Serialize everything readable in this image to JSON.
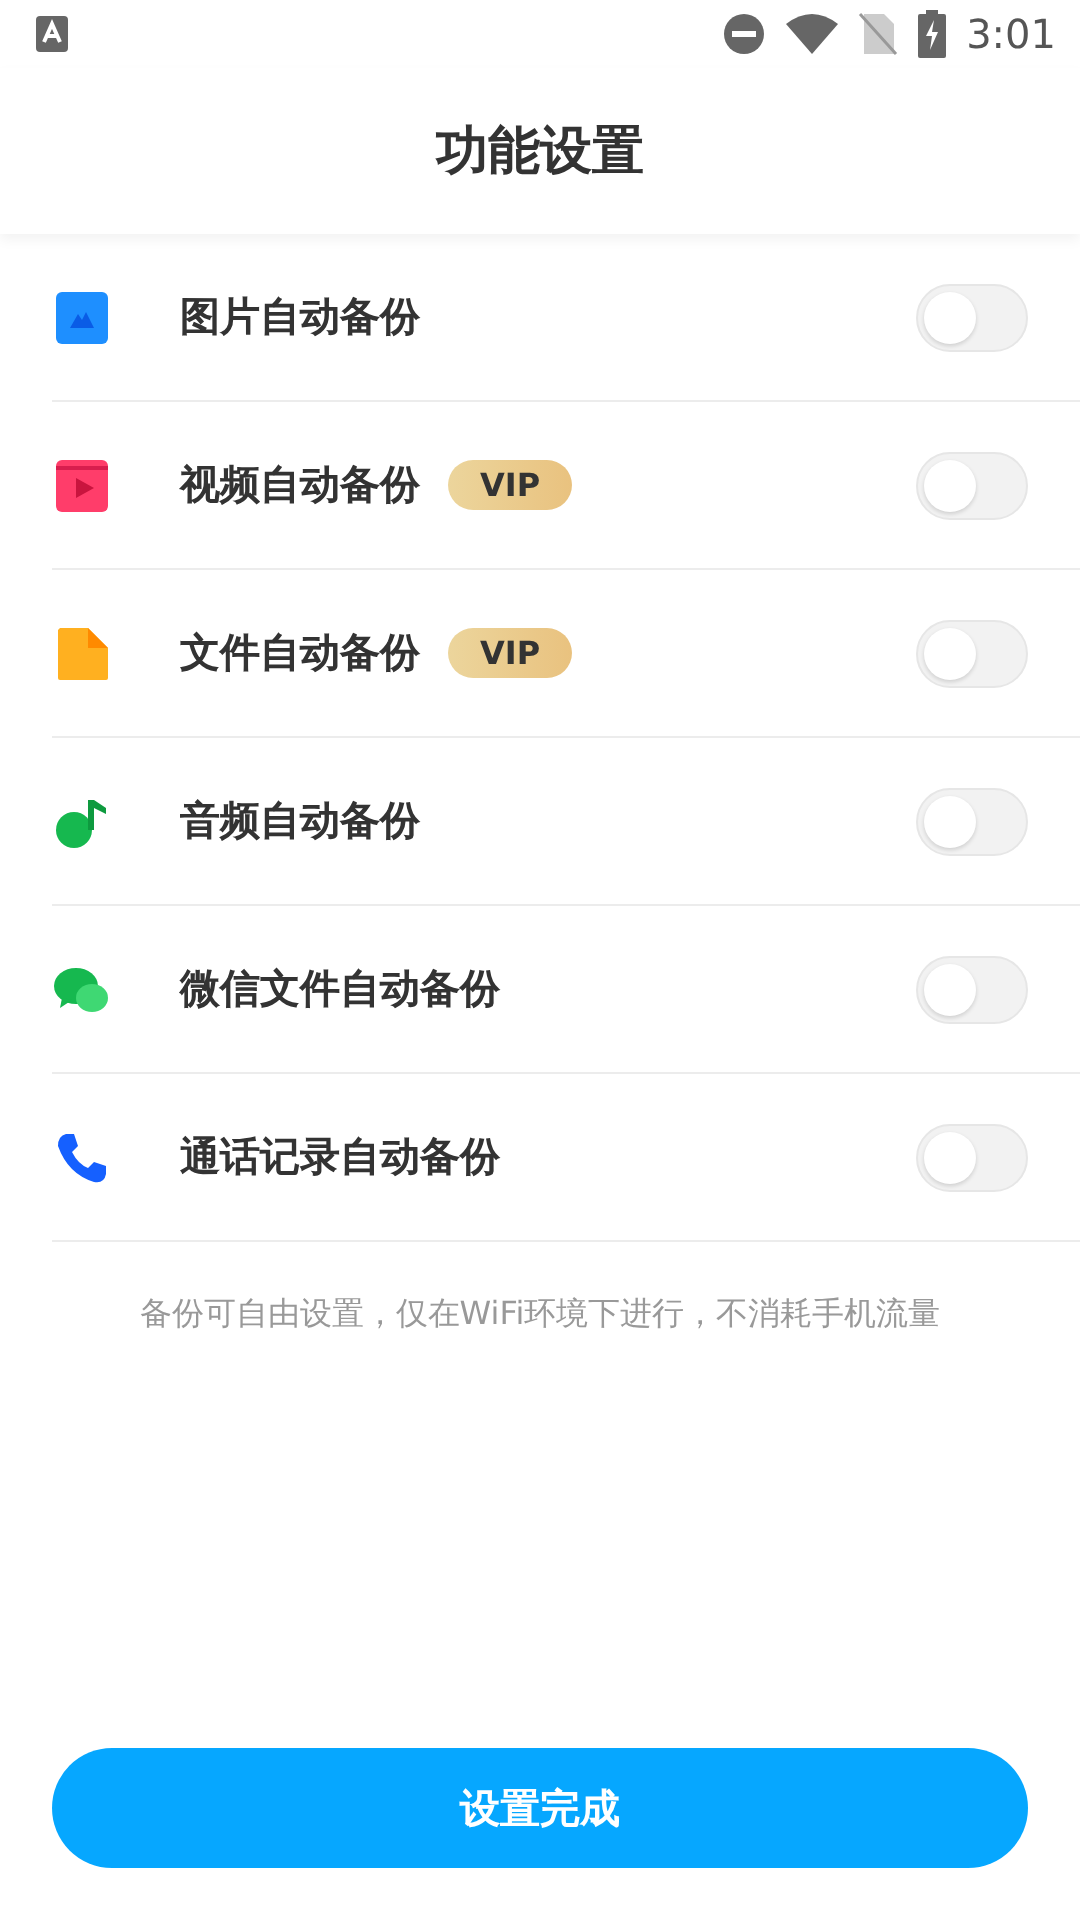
{
  "status_bar": {
    "time": "3:01"
  },
  "header": {
    "title": "功能设置"
  },
  "items": [
    {
      "kind": "image",
      "label": "图片自动备份",
      "on": false
    },
    {
      "kind": "video",
      "label": "视频自动备份",
      "badge": "VIP",
      "on": false
    },
    {
      "kind": "file",
      "label": "文件自动备份",
      "badge": "VIP",
      "on": false
    },
    {
      "kind": "audio",
      "label": "音频自动备份",
      "on": false
    },
    {
      "kind": "wechat",
      "label": "微信文件自动备份",
      "on": false
    },
    {
      "kind": "phone",
      "label": "通话记录自动备份",
      "on": false
    }
  ],
  "note": "备份可自由设置，仅在WiFi环境下进行，不消耗手机流量",
  "button": "设置完成"
}
